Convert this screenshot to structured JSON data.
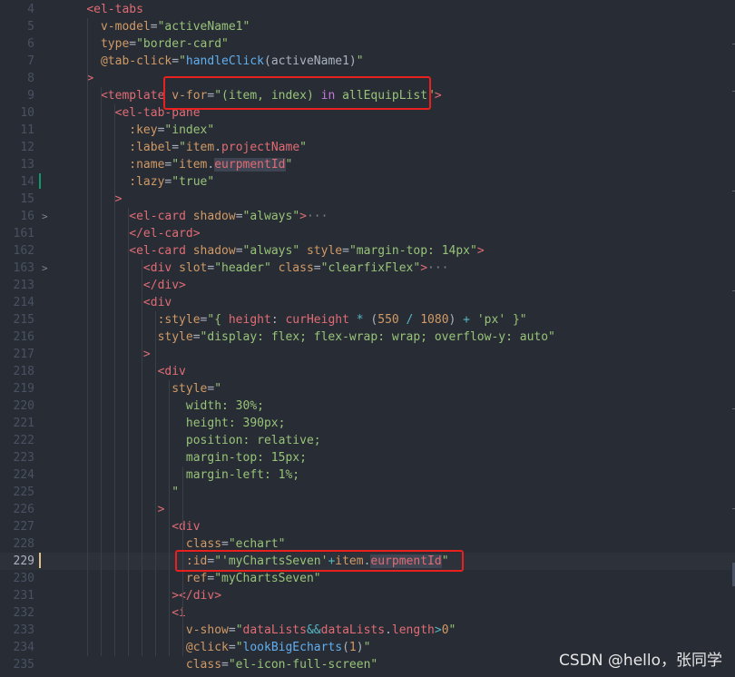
{
  "editor": {
    "lines": [
      {
        "no": "4",
        "fold": "",
        "active": false,
        "guides": [],
        "tokens": [
          {
            "t": "    ",
            "c": ""
          },
          {
            "t": "<el-tabs",
            "c": "t-tag"
          }
        ]
      },
      {
        "no": "5",
        "fold": "",
        "active": false,
        "guides": [],
        "tokens": [
          {
            "t": "      ",
            "c": ""
          },
          {
            "t": "v-model",
            "c": "t-attr"
          },
          {
            "t": "=",
            "c": "t-punc"
          },
          {
            "t": "\"activeName1\"",
            "c": "t-str"
          }
        ]
      },
      {
        "no": "6",
        "fold": "",
        "active": false,
        "guides": [],
        "tokens": [
          {
            "t": "      ",
            "c": ""
          },
          {
            "t": "type",
            "c": "t-attr"
          },
          {
            "t": "=",
            "c": "t-punc"
          },
          {
            "t": "\"border-card\"",
            "c": "t-str"
          }
        ]
      },
      {
        "no": "7",
        "fold": "",
        "active": false,
        "guides": [],
        "tokens": [
          {
            "t": "      ",
            "c": ""
          },
          {
            "t": "@tab-click",
            "c": "t-attr"
          },
          {
            "t": "=",
            "c": "t-punc"
          },
          {
            "t": "\"",
            "c": "t-str"
          },
          {
            "t": "handleClick",
            "c": "t-fn"
          },
          {
            "t": "(activeName1)",
            "c": "t-punc"
          },
          {
            "t": "\"",
            "c": "t-str"
          }
        ]
      },
      {
        "no": "8",
        "fold": "",
        "active": false,
        "guides": [],
        "tokens": [
          {
            "t": "    ",
            "c": ""
          },
          {
            "t": ">",
            "c": "t-tag"
          }
        ]
      },
      {
        "no": "9",
        "fold": "",
        "active": false,
        "guides": [],
        "tokens": [
          {
            "t": "      ",
            "c": ""
          },
          {
            "t": "<template",
            "c": "t-tag"
          },
          {
            "t": " ",
            "c": ""
          },
          {
            "t": "v-for",
            "c": "t-attr"
          },
          {
            "t": "=",
            "c": "t-punc"
          },
          {
            "t": "\"(item, index) ",
            "c": "t-str"
          },
          {
            "t": "in",
            "c": "t-kw"
          },
          {
            "t": " allEquipList\"",
            "c": "t-str"
          },
          {
            "t": ">",
            "c": "t-tag"
          }
        ]
      },
      {
        "no": "10",
        "fold": "",
        "active": false,
        "guides": [],
        "tokens": [
          {
            "t": "        ",
            "c": ""
          },
          {
            "t": "<el-tab-pane",
            "c": "t-tag"
          }
        ]
      },
      {
        "no": "11",
        "fold": "",
        "active": false,
        "guides": [],
        "tokens": [
          {
            "t": "          ",
            "c": ""
          },
          {
            "t": ":key",
            "c": "t-attr"
          },
          {
            "t": "=",
            "c": "t-punc"
          },
          {
            "t": "\"index\"",
            "c": "t-str"
          }
        ]
      },
      {
        "no": "12",
        "fold": "",
        "active": false,
        "guides": [],
        "tokens": [
          {
            "t": "          ",
            "c": ""
          },
          {
            "t": ":label",
            "c": "t-attr"
          },
          {
            "t": "=",
            "c": "t-punc"
          },
          {
            "t": "\"",
            "c": "t-str"
          },
          {
            "t": "item",
            "c": "t-attr"
          },
          {
            "t": ".",
            "c": "t-punc"
          },
          {
            "t": "projectName",
            "c": "t-tag"
          },
          {
            "t": "\"",
            "c": "t-str"
          }
        ]
      },
      {
        "no": "13",
        "fold": "",
        "active": false,
        "guides": [],
        "tokens": [
          {
            "t": "          ",
            "c": ""
          },
          {
            "t": ":name",
            "c": "t-attr"
          },
          {
            "t": "=",
            "c": "t-punc"
          },
          {
            "t": "\"",
            "c": "t-str"
          },
          {
            "t": "item",
            "c": "t-attr"
          },
          {
            "t": ".",
            "c": "t-punc"
          },
          {
            "t": "eurpmentId",
            "c": "t-tag t-hl"
          },
          {
            "t": "\"",
            "c": "t-str"
          }
        ]
      },
      {
        "no": "14",
        "fold": "",
        "active": false,
        "guides": [],
        "tokens": [
          {
            "t": "          ",
            "c": ""
          },
          {
            "t": ":lazy",
            "c": "t-attr"
          },
          {
            "t": "=",
            "c": "t-punc"
          },
          {
            "t": "\"true\"",
            "c": "t-str"
          }
        ]
      },
      {
        "no": "15",
        "fold": "",
        "active": false,
        "guides": [],
        "tokens": [
          {
            "t": "        ",
            "c": ""
          },
          {
            "t": ">",
            "c": "t-tag"
          }
        ]
      },
      {
        "no": "16",
        "fold": ">",
        "active": false,
        "guides": [],
        "tokens": [
          {
            "t": "          ",
            "c": ""
          },
          {
            "t": "<el-card",
            "c": "t-tag"
          },
          {
            "t": " ",
            "c": ""
          },
          {
            "t": "shadow",
            "c": "t-attr"
          },
          {
            "t": "=",
            "c": "t-punc"
          },
          {
            "t": "\"always\"",
            "c": "t-str"
          },
          {
            "t": ">",
            "c": "t-tag"
          },
          {
            "t": "···",
            "c": "t-ellipsis"
          }
        ]
      },
      {
        "no": "161",
        "fold": "",
        "active": false,
        "guides": [],
        "tokens": [
          {
            "t": "          ",
            "c": ""
          },
          {
            "t": "</el-card>",
            "c": "t-tag"
          }
        ]
      },
      {
        "no": "162",
        "fold": "",
        "active": false,
        "guides": [],
        "tokens": [
          {
            "t": "          ",
            "c": ""
          },
          {
            "t": "<el-card",
            "c": "t-tag"
          },
          {
            "t": " ",
            "c": ""
          },
          {
            "t": "shadow",
            "c": "t-attr"
          },
          {
            "t": "=",
            "c": "t-punc"
          },
          {
            "t": "\"always\"",
            "c": "t-str"
          },
          {
            "t": " ",
            "c": ""
          },
          {
            "t": "style",
            "c": "t-attr"
          },
          {
            "t": "=",
            "c": "t-punc"
          },
          {
            "t": "\"margin-top: 14px\"",
            "c": "t-str"
          },
          {
            "t": ">",
            "c": "t-tag"
          }
        ]
      },
      {
        "no": "163",
        "fold": ">",
        "active": false,
        "guides": [],
        "tokens": [
          {
            "t": "            ",
            "c": ""
          },
          {
            "t": "<div",
            "c": "t-tag"
          },
          {
            "t": " ",
            "c": ""
          },
          {
            "t": "slot",
            "c": "t-attr"
          },
          {
            "t": "=",
            "c": "t-punc"
          },
          {
            "t": "\"header\"",
            "c": "t-str"
          },
          {
            "t": " ",
            "c": ""
          },
          {
            "t": "class",
            "c": "t-attr"
          },
          {
            "t": "=",
            "c": "t-punc"
          },
          {
            "t": "\"clearfixFlex\"",
            "c": "t-str"
          },
          {
            "t": ">",
            "c": "t-tag"
          },
          {
            "t": "···",
            "c": "t-ellipsis"
          }
        ]
      },
      {
        "no": "213",
        "fold": "",
        "active": false,
        "guides": [],
        "tokens": [
          {
            "t": "            ",
            "c": ""
          },
          {
            "t": "</div>",
            "c": "t-tag"
          }
        ]
      },
      {
        "no": "214",
        "fold": "",
        "active": false,
        "guides": [],
        "tokens": [
          {
            "t": "            ",
            "c": ""
          },
          {
            "t": "<div",
            "c": "t-tag"
          }
        ]
      },
      {
        "no": "215",
        "fold": "",
        "active": false,
        "guides": [],
        "tokens": [
          {
            "t": "              ",
            "c": ""
          },
          {
            "t": ":style",
            "c": "t-attr"
          },
          {
            "t": "=",
            "c": "t-punc"
          },
          {
            "t": "\"{ ",
            "c": "t-str"
          },
          {
            "t": "height",
            "c": "t-tag"
          },
          {
            "t": ": ",
            "c": "t-punc"
          },
          {
            "t": "curHeight",
            "c": "t-tag"
          },
          {
            "t": " * ",
            "c": "t-op"
          },
          {
            "t": "(",
            "c": "t-punc"
          },
          {
            "t": "550",
            "c": "t-num"
          },
          {
            "t": " / ",
            "c": "t-op"
          },
          {
            "t": "1080",
            "c": "t-num"
          },
          {
            "t": ")",
            "c": "t-punc"
          },
          {
            "t": " + ",
            "c": "t-op"
          },
          {
            "t": "'px'",
            "c": "t-str"
          },
          {
            "t": " }\"",
            "c": "t-str"
          }
        ]
      },
      {
        "no": "216",
        "fold": "",
        "active": false,
        "guides": [],
        "tokens": [
          {
            "t": "              ",
            "c": ""
          },
          {
            "t": "style",
            "c": "t-attr"
          },
          {
            "t": "=",
            "c": "t-punc"
          },
          {
            "t": "\"display: flex; flex-wrap: wrap; overflow-y: auto\"",
            "c": "t-str"
          }
        ]
      },
      {
        "no": "217",
        "fold": "",
        "active": false,
        "guides": [],
        "tokens": [
          {
            "t": "            ",
            "c": ""
          },
          {
            "t": ">",
            "c": "t-tag"
          }
        ]
      },
      {
        "no": "218",
        "fold": "",
        "active": false,
        "guides": [],
        "tokens": [
          {
            "t": "              ",
            "c": ""
          },
          {
            "t": "<div",
            "c": "t-tag"
          }
        ]
      },
      {
        "no": "219",
        "fold": "",
        "active": false,
        "guides": [],
        "tokens": [
          {
            "t": "                ",
            "c": ""
          },
          {
            "t": "style",
            "c": "t-attr"
          },
          {
            "t": "=",
            "c": "t-punc"
          },
          {
            "t": "\"",
            "c": "t-str"
          }
        ]
      },
      {
        "no": "220",
        "fold": "",
        "active": false,
        "guides": [],
        "tokens": [
          {
            "t": "                  ",
            "c": ""
          },
          {
            "t": "width: 30%;",
            "c": "t-str"
          }
        ]
      },
      {
        "no": "221",
        "fold": "",
        "active": false,
        "guides": [],
        "tokens": [
          {
            "t": "                  ",
            "c": ""
          },
          {
            "t": "height: 390px;",
            "c": "t-str"
          }
        ]
      },
      {
        "no": "222",
        "fold": "",
        "active": false,
        "guides": [],
        "tokens": [
          {
            "t": "                  ",
            "c": ""
          },
          {
            "t": "position: relative;",
            "c": "t-str"
          }
        ]
      },
      {
        "no": "223",
        "fold": "",
        "active": false,
        "guides": [],
        "tokens": [
          {
            "t": "                  ",
            "c": ""
          },
          {
            "t": "margin-top: 15px;",
            "c": "t-str"
          }
        ]
      },
      {
        "no": "224",
        "fold": "",
        "active": false,
        "guides": [],
        "tokens": [
          {
            "t": "                  ",
            "c": ""
          },
          {
            "t": "margin-left: 1%;",
            "c": "t-str"
          }
        ]
      },
      {
        "no": "225",
        "fold": "",
        "active": false,
        "guides": [],
        "tokens": [
          {
            "t": "                ",
            "c": ""
          },
          {
            "t": "\"",
            "c": "t-str"
          }
        ]
      },
      {
        "no": "226",
        "fold": "",
        "active": false,
        "guides": [],
        "tokens": [
          {
            "t": "              ",
            "c": ""
          },
          {
            "t": ">",
            "c": "t-tag"
          }
        ]
      },
      {
        "no": "227",
        "fold": "",
        "active": false,
        "guides": [],
        "tokens": [
          {
            "t": "                ",
            "c": ""
          },
          {
            "t": "<div",
            "c": "t-tag"
          }
        ]
      },
      {
        "no": "228",
        "fold": "",
        "active": false,
        "guides": [],
        "tokens": [
          {
            "t": "                  ",
            "c": ""
          },
          {
            "t": "class",
            "c": "t-attr"
          },
          {
            "t": "=",
            "c": "t-punc"
          },
          {
            "t": "\"echart\"",
            "c": "t-str"
          }
        ]
      },
      {
        "no": "229",
        "fold": "",
        "active": true,
        "guides": [],
        "tokens": [
          {
            "t": "                  ",
            "c": ""
          },
          {
            "t": ":id",
            "c": "t-attr"
          },
          {
            "t": "=",
            "c": "t-punc"
          },
          {
            "t": "\"",
            "c": "t-str"
          },
          {
            "t": "'myChartsSeven'",
            "c": "t-str"
          },
          {
            "t": "+",
            "c": "t-op"
          },
          {
            "t": "item",
            "c": "t-attr"
          },
          {
            "t": ".",
            "c": "t-punc"
          },
          {
            "t": "eurpmentId",
            "c": "t-tag t-hl"
          },
          {
            "t": "\"",
            "c": "t-str"
          }
        ]
      },
      {
        "no": "230",
        "fold": "",
        "active": false,
        "guides": [],
        "tokens": [
          {
            "t": "                  ",
            "c": ""
          },
          {
            "t": "ref",
            "c": "t-attr"
          },
          {
            "t": "=",
            "c": "t-punc"
          },
          {
            "t": "\"myChartsSeven\"",
            "c": "t-str"
          }
        ]
      },
      {
        "no": "231",
        "fold": "",
        "active": false,
        "guides": [],
        "tokens": [
          {
            "t": "                ",
            "c": ""
          },
          {
            "t": "></div>",
            "c": "t-tag"
          }
        ]
      },
      {
        "no": "232",
        "fold": "",
        "active": false,
        "guides": [],
        "tokens": [
          {
            "t": "                ",
            "c": ""
          },
          {
            "t": "<i",
            "c": "t-tag"
          }
        ]
      },
      {
        "no": "233",
        "fold": "",
        "active": false,
        "guides": [],
        "tokens": [
          {
            "t": "                  ",
            "c": ""
          },
          {
            "t": "v-show",
            "c": "t-attr"
          },
          {
            "t": "=",
            "c": "t-punc"
          },
          {
            "t": "\"",
            "c": "t-str"
          },
          {
            "t": "dataLists",
            "c": "t-tag"
          },
          {
            "t": "&&",
            "c": "t-op"
          },
          {
            "t": "dataLists",
            "c": "t-tag"
          },
          {
            "t": ".",
            "c": "t-punc"
          },
          {
            "t": "length",
            "c": "t-tag"
          },
          {
            "t": ">",
            "c": "t-op"
          },
          {
            "t": "0",
            "c": "t-num"
          },
          {
            "t": "\"",
            "c": "t-str"
          }
        ]
      },
      {
        "no": "234",
        "fold": "",
        "active": false,
        "guides": [],
        "tokens": [
          {
            "t": "                  ",
            "c": ""
          },
          {
            "t": "@click",
            "c": "t-attr"
          },
          {
            "t": "=",
            "c": "t-punc"
          },
          {
            "t": "\"",
            "c": "t-str"
          },
          {
            "t": "lookBigEcharts",
            "c": "t-fn"
          },
          {
            "t": "(",
            "c": "t-punc"
          },
          {
            "t": "1",
            "c": "t-num"
          },
          {
            "t": ")",
            "c": "t-punc"
          },
          {
            "t": "\"",
            "c": "t-str"
          }
        ]
      },
      {
        "no": "235",
        "fold": "",
        "active": false,
        "guides": [],
        "tokens": [
          {
            "t": "                  ",
            "c": ""
          },
          {
            "t": "class",
            "c": "t-attr"
          },
          {
            "t": "=",
            "c": "t-punc"
          },
          {
            "t": "\"el-icon-full-screen\"",
            "c": "t-str"
          }
        ]
      }
    ]
  },
  "watermark": "CSDN @hello，张同学",
  "colors": {
    "background": "#282c34",
    "highlight_box": "#e8201e",
    "git_modified": "#e2c08d",
    "git_added": "#109868"
  }
}
